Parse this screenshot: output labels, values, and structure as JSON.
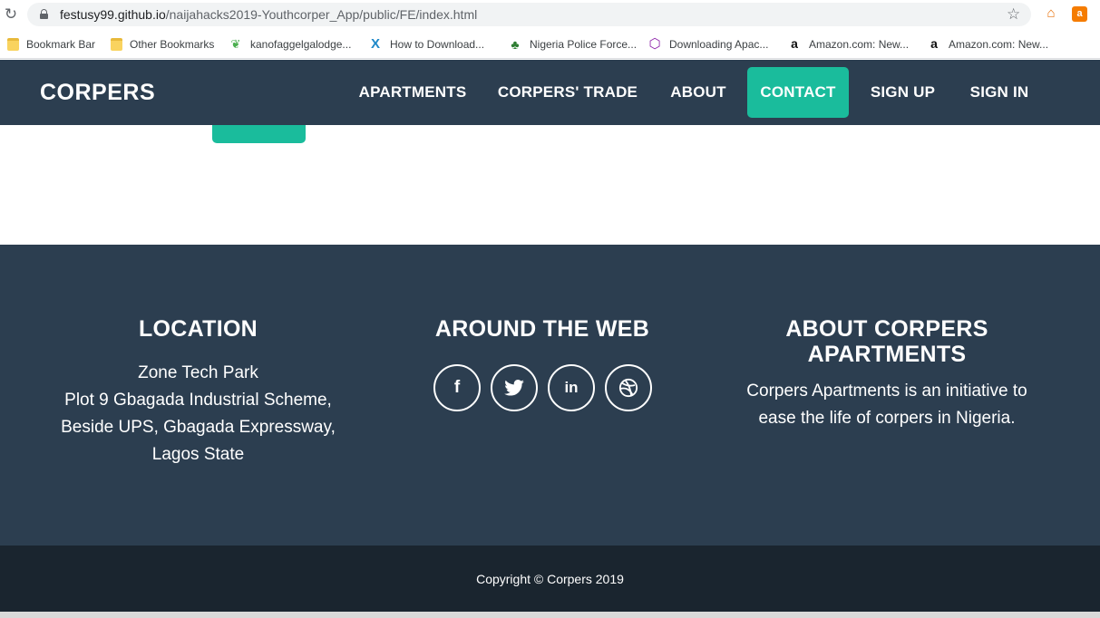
{
  "browser": {
    "url_host": "festusy99.github.io",
    "url_path": "/naijahacks2019-Youthcorper_App/public/FE/index.html",
    "bookmarks": [
      {
        "label": "Bookmark Bar",
        "icon": "folder-icon"
      },
      {
        "label": "Other Bookmarks",
        "icon": "folder-icon"
      },
      {
        "label": "kanofaggelgalodge...",
        "icon": "leaf-icon"
      },
      {
        "label": "How to Download...",
        "icon": "x-logo-icon"
      },
      {
        "label": "Nigeria Police Force...",
        "icon": "crest-icon"
      },
      {
        "label": "Downloading Apac...",
        "icon": "hexagon-icon"
      },
      {
        "label": "Amazon.com: New...",
        "icon": "amazon-icon"
      },
      {
        "label": "Amazon.com: New...",
        "icon": "amazon-icon"
      }
    ]
  },
  "navbar": {
    "brand": "CORPERS",
    "links": [
      {
        "label": "APARTMENTS"
      },
      {
        "label": "CORPERS' TRADE"
      },
      {
        "label": "ABOUT"
      },
      {
        "label": "CONTACT",
        "active": true
      },
      {
        "label": "SIGN UP"
      },
      {
        "label": "SIGN IN"
      }
    ]
  },
  "footer": {
    "location": {
      "title": "LOCATION",
      "lines": [
        "Zone Tech Park",
        "Plot 9 Gbagada Industrial Scheme,",
        "Beside UPS, Gbagada Expressway,",
        "Lagos State"
      ]
    },
    "web": {
      "title": "AROUND THE WEB",
      "social": [
        "facebook-icon",
        "twitter-icon",
        "linkedin-icon",
        "dribbble-icon"
      ]
    },
    "about": {
      "title_line1": "ABOUT CORPERS",
      "title_line2": "APARTMENTS",
      "text_line1": "Corpers Apartments is an initiative to",
      "text_line2": "ease the life of corpers in Nigeria."
    },
    "copyright": "Copyright © Corpers 2019"
  },
  "colors": {
    "navbar_bg": "#2c3e50",
    "accent": "#1abc9c",
    "copyright_bg": "#1a252f"
  }
}
